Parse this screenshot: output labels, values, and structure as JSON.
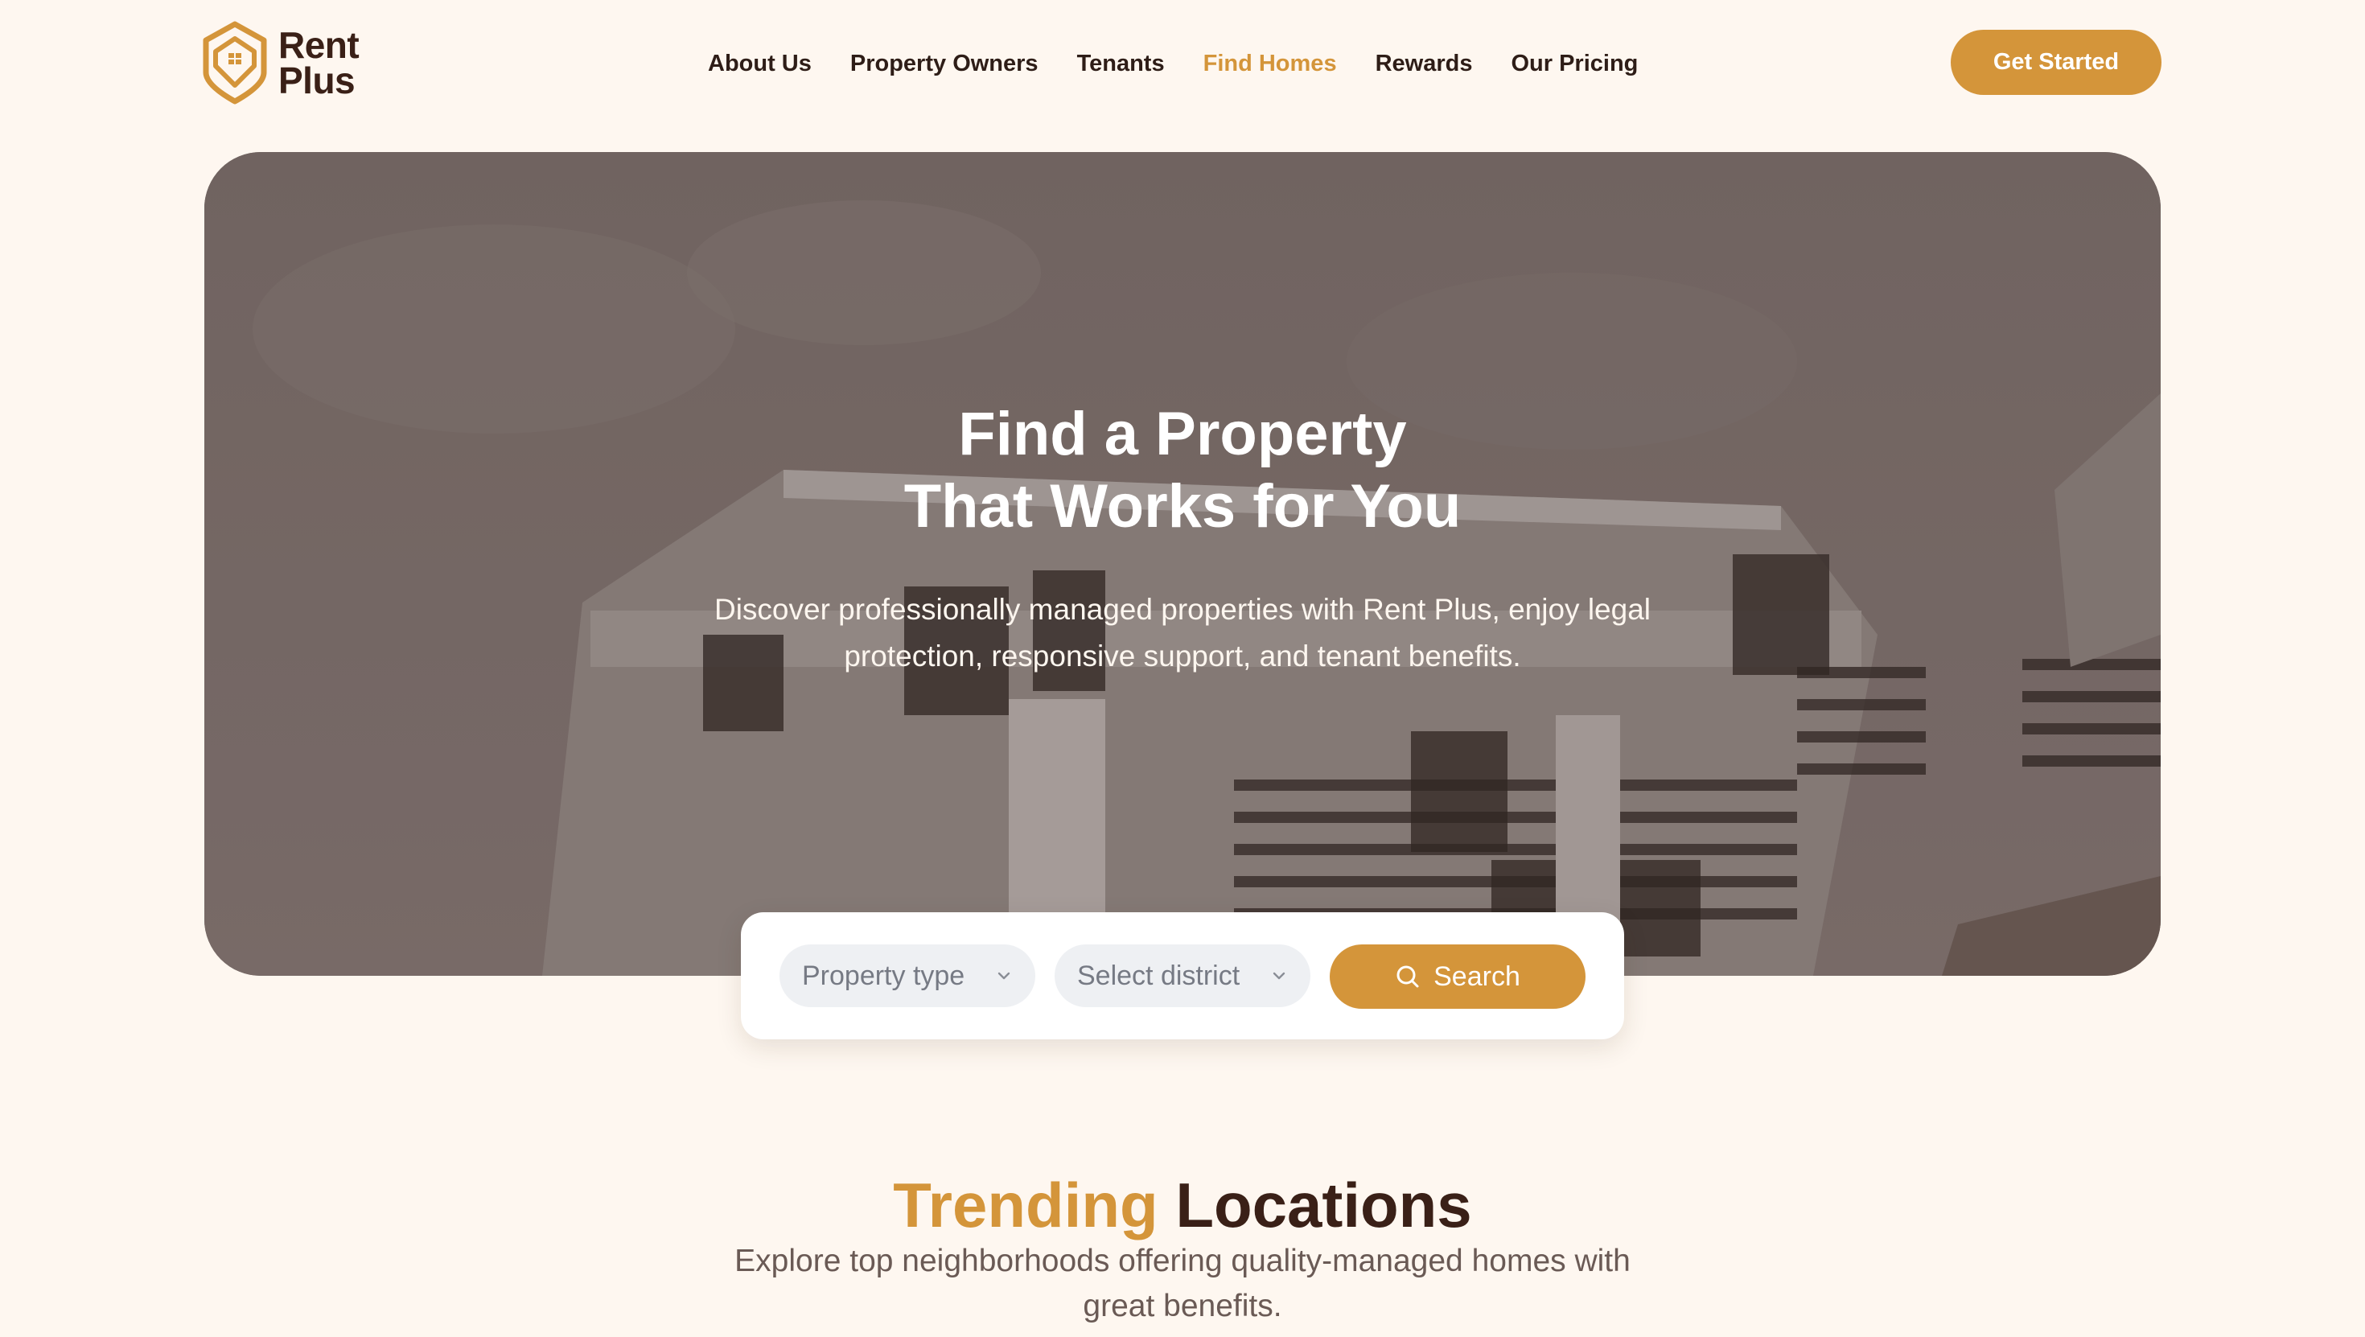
{
  "brand": {
    "line1": "Rent",
    "line2": "Plus",
    "accent": "#d4953a",
    "dark": "#3a2017"
  },
  "nav": {
    "items": [
      {
        "label": "About Us"
      },
      {
        "label": "Property Owners"
      },
      {
        "label": "Tenants"
      },
      {
        "label": "Find Homes",
        "active": true
      },
      {
        "label": "Rewards"
      },
      {
        "label": "Our Pricing"
      }
    ]
  },
  "header": {
    "cta_label": "Get Started"
  },
  "hero": {
    "title_line1": "Find a Property",
    "title_line2": "That Works for You",
    "subtitle": "Discover professionally managed properties with Rent Plus, enjoy legal protection, responsive support, and tenant benefits."
  },
  "search": {
    "property_type": "Property type",
    "district": "Select district",
    "button_label": "Search",
    "icons": {
      "select": "chevron-down-icon",
      "button": "search-icon"
    }
  },
  "trending": {
    "title_accent": "Trending",
    "title_rest": "Locations",
    "subtitle": "Explore top neighborhoods offering quality-managed homes with great benefits."
  }
}
